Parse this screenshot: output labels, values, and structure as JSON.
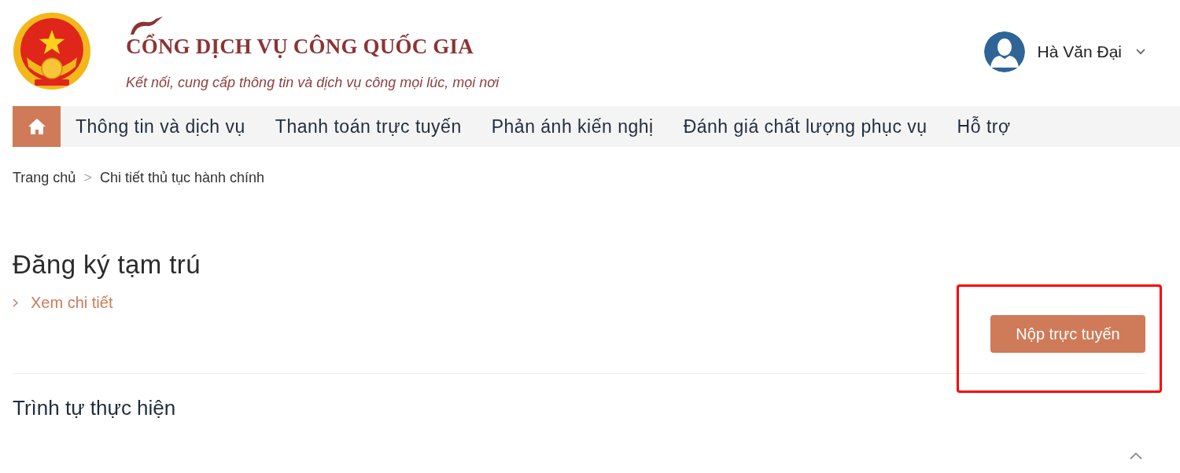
{
  "header": {
    "logo": {
      "title": "CỔNG DỊCH VỤ CÔNG QUỐC GIA",
      "tagline": "Kết nối, cung cấp thông tin và dịch vụ công mọi lúc, mọi nơi"
    },
    "user_menu": {
      "name": "Hà Văn Đại",
      "expanded": false
    }
  },
  "nav": {
    "items": [
      {
        "kind": "home",
        "selected": true
      },
      {
        "kind": "link",
        "label": "Thông tin và dịch vụ",
        "selected": false
      },
      {
        "kind": "link",
        "label": "Thanh toán trực tuyến",
        "selected": false
      },
      {
        "kind": "link",
        "label": "Phản ánh kiến nghị",
        "selected": false
      },
      {
        "kind": "link",
        "label": "Đánh giá chất lượng phục vụ",
        "selected": false
      },
      {
        "kind": "link",
        "label": "Hỗ trợ",
        "selected": false
      }
    ]
  },
  "breadcrumb": {
    "separator": ">",
    "items": [
      {
        "label": "Trang chủ"
      },
      {
        "label": "Chi tiết thủ tục hành chính"
      }
    ]
  },
  "procedure": {
    "title": "Đăng ký tạm trú",
    "details_link": "Xem chi tiết",
    "submit_button": {
      "label": "Nộp trực tuyến",
      "highlighted": true
    }
  },
  "sections": [
    {
      "title": "Trình tự thực hiện"
    }
  ],
  "collapse_toggle": {
    "expanded": true
  }
}
